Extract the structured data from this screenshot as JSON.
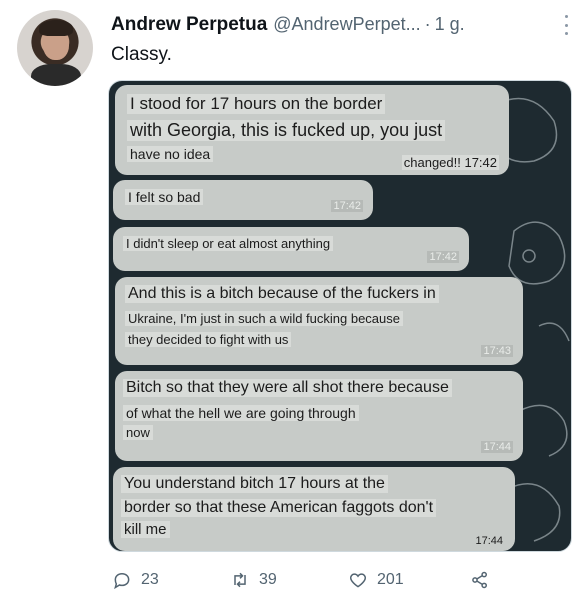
{
  "tweet": {
    "author_name": "Andrew Perpetua",
    "handle": "@AndrewPerpet...",
    "separator": "·",
    "time": "1 g.",
    "text": "Classy."
  },
  "image": {
    "messages": [
      {
        "lines": [
          "I stood for 17 hours on the border",
          "with Georgia, this is fucked up, you just",
          "have no idea"
        ],
        "timestamp": "changed!! 17:42"
      },
      {
        "lines": [
          "I felt so bad"
        ],
        "timestamp": "17:42"
      },
      {
        "lines": [
          "I didn't sleep or eat almost anything"
        ],
        "timestamp": "17:42"
      },
      {
        "lines": [
          "And this is a bitch because of the fuckers in",
          "Ukraine, I'm just in such a wild fucking because",
          "they decided to fight with us"
        ],
        "timestamp": "17:43"
      },
      {
        "lines": [
          "Bitch so that they were all shot there because",
          "of what the hell we are going through",
          "now"
        ],
        "timestamp": "17:44"
      },
      {
        "lines": [
          "You understand bitch 17 hours at the",
          "border so that these American faggots don't",
          "kill me"
        ],
        "timestamp": "17:44"
      }
    ]
  },
  "actions": {
    "replies": "23",
    "retweets": "39",
    "likes": "201"
  },
  "icons": {
    "reply": "reply-icon",
    "retweet": "retweet-icon",
    "like": "heart-icon",
    "share": "share-icon",
    "more": "more-icon"
  },
  "colors": {
    "secondary_text": "#536471",
    "bubble": "#c7cbc8",
    "chat_background": "#1e2a30"
  }
}
